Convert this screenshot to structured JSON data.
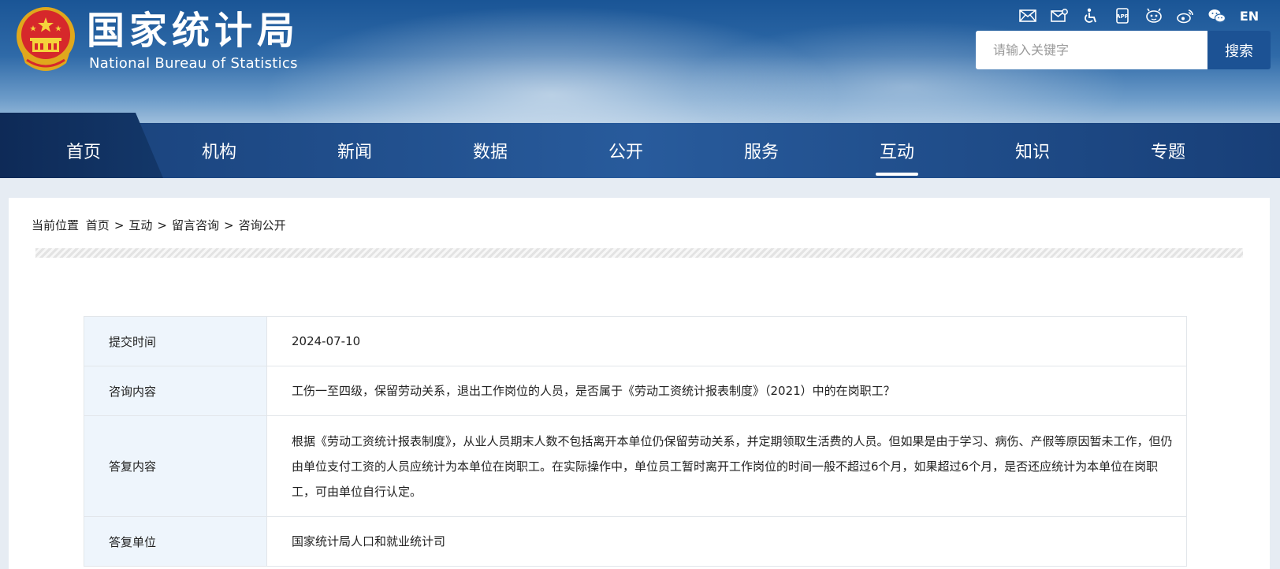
{
  "header": {
    "title_cn": "国家统计局",
    "title_en": "National Bureau of Statistics",
    "tools": [
      {
        "icon": "mail-icon"
      },
      {
        "icon": "mail-settings-icon"
      },
      {
        "icon": "accessibility-icon"
      },
      {
        "icon": "app-icon"
      },
      {
        "icon": "weibo-robot-icon"
      },
      {
        "icon": "weibo-icon"
      },
      {
        "icon": "wechat-icon"
      }
    ],
    "lang_label": "EN",
    "search_placeholder": "请输入关键字",
    "search_button": "搜索"
  },
  "nav": {
    "items": [
      "首页",
      "机构",
      "新闻",
      "数据",
      "公开",
      "服务",
      "互动",
      "知识",
      "专题"
    ],
    "active": "互动"
  },
  "breadcrumb": {
    "prefix": "当前位置",
    "items": [
      "首页",
      "互动",
      "留言咨询",
      "咨询公开"
    ],
    "separator": ">"
  },
  "record": {
    "rows": [
      {
        "label": "提交时间",
        "value": "2024-07-10"
      },
      {
        "label": "咨询内容",
        "value": "工伤一至四级，保留劳动关系，退出工作岗位的人员，是否属于《劳动工资统计报表制度》（2021）中的在岗职工？"
      },
      {
        "label": "答复内容",
        "value": "根据《劳动工资统计报表制度》，从业人员期末人数不包括离开本单位仍保留劳动关系，并定期领取生活费的人员。但如果是由于学习、病伤、产假等原因暂未工作，但仍由单位支付工资的人员应统计为本单位在岗职工。在实际操作中，单位员工暂时离开工作岗位的时间一般不超过6个月，如果超过6个月，是否还应统计为本单位在岗职工，可由单位自行认定。"
      },
      {
        "label": "答复单位",
        "value": "国家统计局人口和就业统计司"
      }
    ]
  },
  "colors": {
    "header_top": "#1a5596",
    "nav_bg": "#285b9c",
    "search_button": "#1c5294",
    "label_bg": "#eef5fc"
  }
}
